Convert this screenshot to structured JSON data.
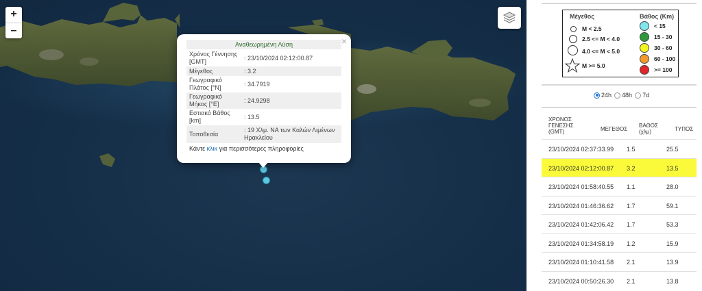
{
  "map": {
    "zoom_in": "+",
    "zoom_out": "–",
    "popup": {
      "title": "Αναθεωρημένη Λύση",
      "close": "×",
      "rows": [
        {
          "label": "Χρόνος Γέννησης [GMT]",
          "value": ": 23/10/2024 02:12:00.87"
        },
        {
          "label": "Μέγεθος",
          "value": ": 3.2"
        },
        {
          "label": "Γεωγραφικό Πλάτος [°N]",
          "value": ": 34.7919"
        },
        {
          "label": "Γεωγραφικό Μήκος [°E]",
          "value": ": 24.9298"
        },
        {
          "label": "Εστιακό Βάθος [km]",
          "value": ": 13.5"
        },
        {
          "label": "Τοποθεσία",
          "value": ": 19 Χλμ. ΝΑ των Καλών Λιμένων Ηρακλείου"
        }
      ],
      "footer_pre": "Κάντε ",
      "footer_link": "κλικ",
      "footer_post": " για περισσότερες πληροφορίες"
    },
    "marker_color": "#5ec8e0"
  },
  "legend": {
    "magnitude_title": "Μέγεθος",
    "depth_title": "Βάθος (Km)",
    "magnitudes": [
      "M < 2.5",
      "2.5 <= M < 4.0",
      "4.0 <= M < 5.0",
      "M >= 5.0"
    ],
    "depths": [
      {
        "label": "< 15",
        "color": "#7fe6ee"
      },
      {
        "label": "15 - 30",
        "color": "#2e9a3a"
      },
      {
        "label": "30 - 60",
        "color": "#f4f41e"
      },
      {
        "label": "60 - 100",
        "color": "#f39a2a"
      },
      {
        "label": ">= 100",
        "color": "#e0262a"
      }
    ]
  },
  "filters": {
    "options": [
      "24h",
      "48h",
      "7d"
    ],
    "selected": "24h"
  },
  "table": {
    "headers": {
      "time": "ΧΡΟΝΟΣ ΓΕΝΕΣΗΣ (GMT)",
      "magnitude": "ΜΕΓΕΘΟΣ",
      "depth": "ΒΑΘΟΣ (χλμ)",
      "type": "ΤΥΠΟΣ"
    },
    "rows": [
      {
        "time": "23/10/2024 02:37:33.99",
        "mag": "1.5",
        "depth": "25.5",
        "highlight": false
      },
      {
        "time": "23/10/2024 02:12:00.87",
        "mag": "3.2",
        "depth": "13.5",
        "highlight": true
      },
      {
        "time": "23/10/2024 01:58:40.55",
        "mag": "1.1",
        "depth": "28.0",
        "highlight": false
      },
      {
        "time": "23/10/2024 01:46:36.62",
        "mag": "1.7",
        "depth": "59.1",
        "highlight": false
      },
      {
        "time": "23/10/2024 01:42:06.42",
        "mag": "1.7",
        "depth": "53.3",
        "highlight": false
      },
      {
        "time": "23/10/2024 01:34:58.19",
        "mag": "1.2",
        "depth": "15.9",
        "highlight": false
      },
      {
        "time": "23/10/2024 01:10:41.58",
        "mag": "2.1",
        "depth": "13.9",
        "highlight": false
      },
      {
        "time": "23/10/2024 00:50:26.30",
        "mag": "2.1",
        "depth": "13.8",
        "highlight": false
      }
    ],
    "highlight_color": "#fafa3a"
  }
}
